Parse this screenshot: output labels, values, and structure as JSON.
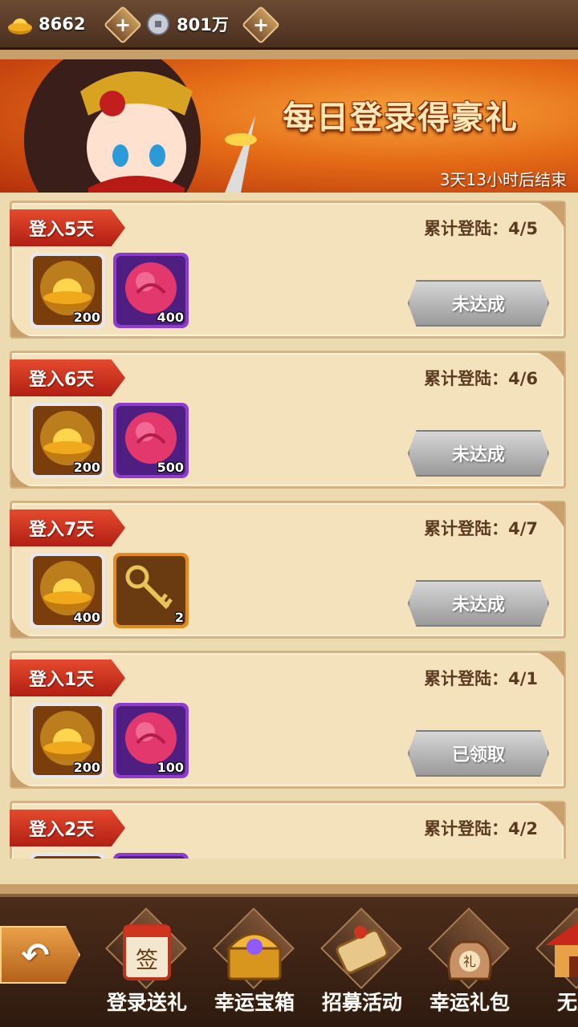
{
  "currencies": {
    "gold": {
      "value": "8662",
      "icon": "gold-ingot-icon"
    },
    "silver": {
      "value": "801万",
      "icon": "silver-coin-icon"
    }
  },
  "banner": {
    "title": "每日登录得豪礼",
    "timer": "3天13小时后结束"
  },
  "cards": [
    {
      "ribbon": "登入5天",
      "progress": "累计登陆：4/5",
      "items": [
        {
          "type": "gold-ingot",
          "count": "200"
        },
        {
          "type": "pink-orb",
          "count": "400"
        }
      ],
      "button": "未达成"
    },
    {
      "ribbon": "登入6天",
      "progress": "累计登陆：4/6",
      "items": [
        {
          "type": "gold-ingot",
          "count": "200"
        },
        {
          "type": "pink-orb",
          "count": "500"
        }
      ],
      "button": "未达成"
    },
    {
      "ribbon": "登入7天",
      "progress": "累计登陆：4/7",
      "items": [
        {
          "type": "gold-ingot",
          "count": "400"
        },
        {
          "type": "golden-key",
          "count": "2"
        }
      ],
      "button": "未达成"
    },
    {
      "ribbon": "登入1天",
      "progress": "累计登陆：4/1",
      "items": [
        {
          "type": "gold-ingot",
          "count": "200"
        },
        {
          "type": "pink-orb",
          "count": "100"
        }
      ],
      "button": "已领取"
    },
    {
      "ribbon": "登入2天",
      "progress": "累计登陆：4/2",
      "items": [
        {
          "type": "gold-ingot",
          "count": ""
        },
        {
          "type": "pink-orb",
          "count": ""
        }
      ],
      "button": ""
    }
  ],
  "nav": [
    {
      "label": "登录送礼",
      "icon": "sign-in-calendar-icon"
    },
    {
      "label": "幸运宝箱",
      "icon": "treasure-chest-icon"
    },
    {
      "label": "招募活动",
      "icon": "scroll-icon"
    },
    {
      "label": "幸运礼包",
      "icon": "gift-bag-icon"
    },
    {
      "label": "无双",
      "icon": "pavilion-icon"
    }
  ],
  "colors": {
    "ribbon": "#d0341e",
    "card_bg": "#f4e2bc",
    "button_gray": "#b8b8b8"
  }
}
